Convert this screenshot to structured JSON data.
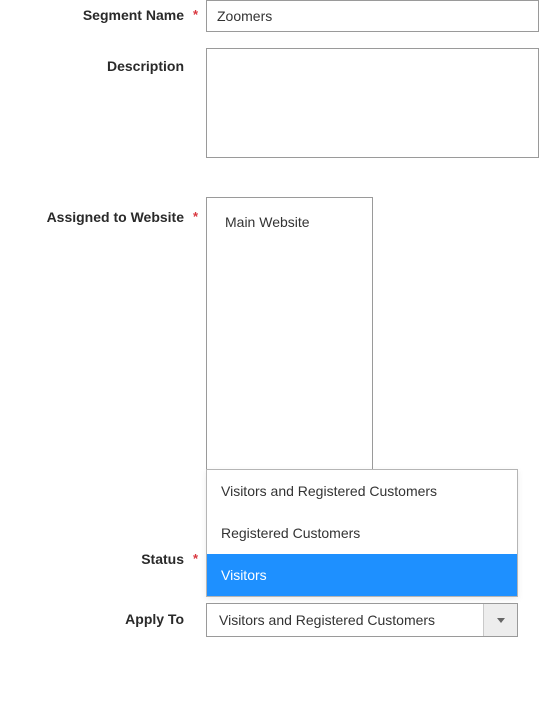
{
  "fields": {
    "segment_name": {
      "label": "Segment Name",
      "required": true,
      "value": "Zoomers"
    },
    "description": {
      "label": "Description",
      "required": false,
      "value": ""
    },
    "assigned_website": {
      "label": "Assigned to Website",
      "required": true,
      "options": [
        "Main Website"
      ]
    },
    "status": {
      "label": "Status",
      "required": true
    },
    "apply_to": {
      "label": "Apply To",
      "required": false,
      "selected": "Visitors and Registered Customers",
      "dropdown_options": [
        {
          "text": "Visitors and Registered Customers",
          "highlighted": false
        },
        {
          "text": "Registered Customers",
          "highlighted": false
        },
        {
          "text": "Visitors",
          "highlighted": true
        }
      ]
    }
  }
}
